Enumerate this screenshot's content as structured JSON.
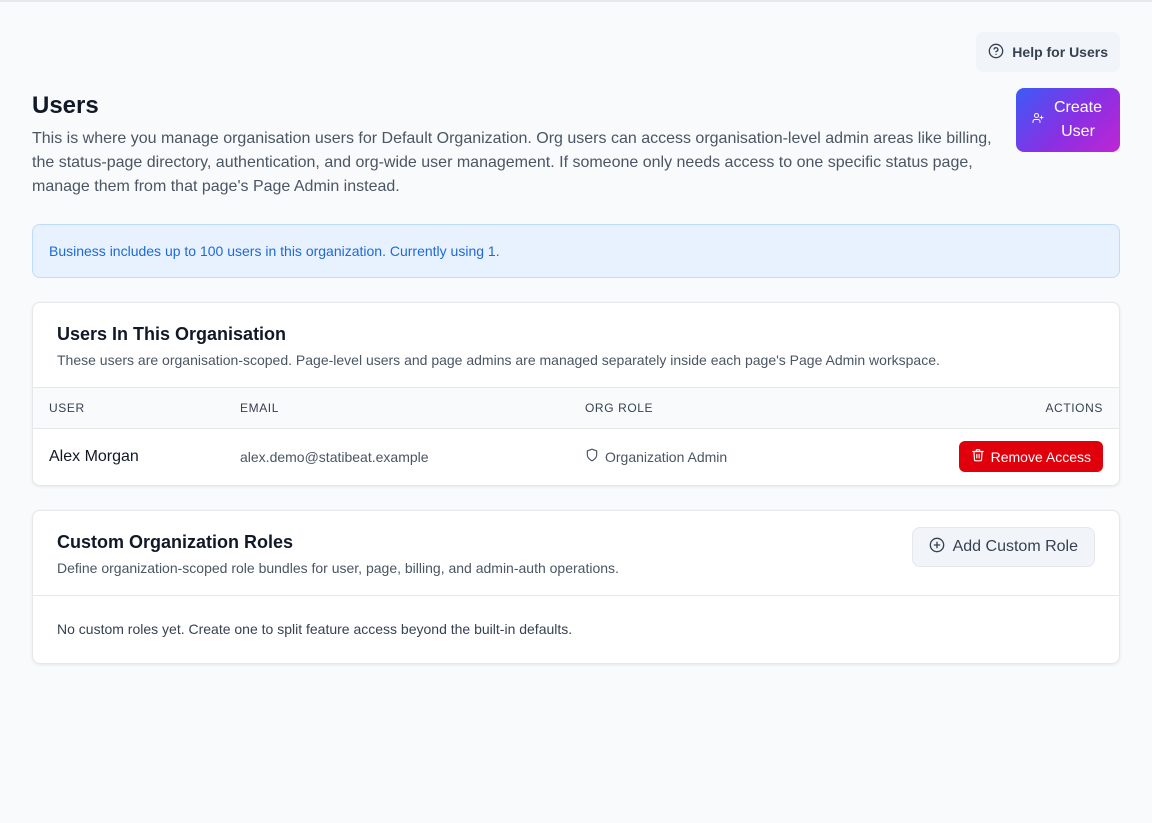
{
  "help": {
    "label": "Help for Users",
    "icon": "help-circle-icon"
  },
  "header": {
    "title": "Users",
    "description": "This is where you manage organisation users for Default Organization. Org users can access organisation-level admin areas like billing, the status-page directory, authentication, and org-wide user management. If someone only needs access to one specific status page, manage them from that page's Page Admin instead.",
    "create_button": "Create User"
  },
  "banner": {
    "text": "Business includes up to 100 users in this organization. Currently using 1."
  },
  "users_card": {
    "title": "Users In This Organisation",
    "subtitle": "These users are organisation-scoped. Page-level users and page admins are managed separately inside each page's Page Admin workspace.",
    "columns": {
      "user": "USER",
      "email": "EMAIL",
      "role": "ORG ROLE",
      "actions": "ACTIONS"
    },
    "rows": [
      {
        "name": "Alex Morgan",
        "email": "alex.demo@statibeat.example",
        "role": "Organization Admin",
        "action": "Remove Access"
      }
    ]
  },
  "roles_card": {
    "title": "Custom Organization Roles",
    "subtitle": "Define organization-scoped role bundles for user, page, billing, and admin-auth operations.",
    "add_button": "Add Custom Role",
    "empty_text": "No custom roles yet. Create one to split feature access beyond the built-in defaults."
  },
  "colors": {
    "primary_gradient_start": "#3b5bf6",
    "primary_gradient_end": "#c026d3",
    "danger": "#e0000b",
    "info_text": "#1d6ad8",
    "info_bg": "#e8f1fe"
  }
}
